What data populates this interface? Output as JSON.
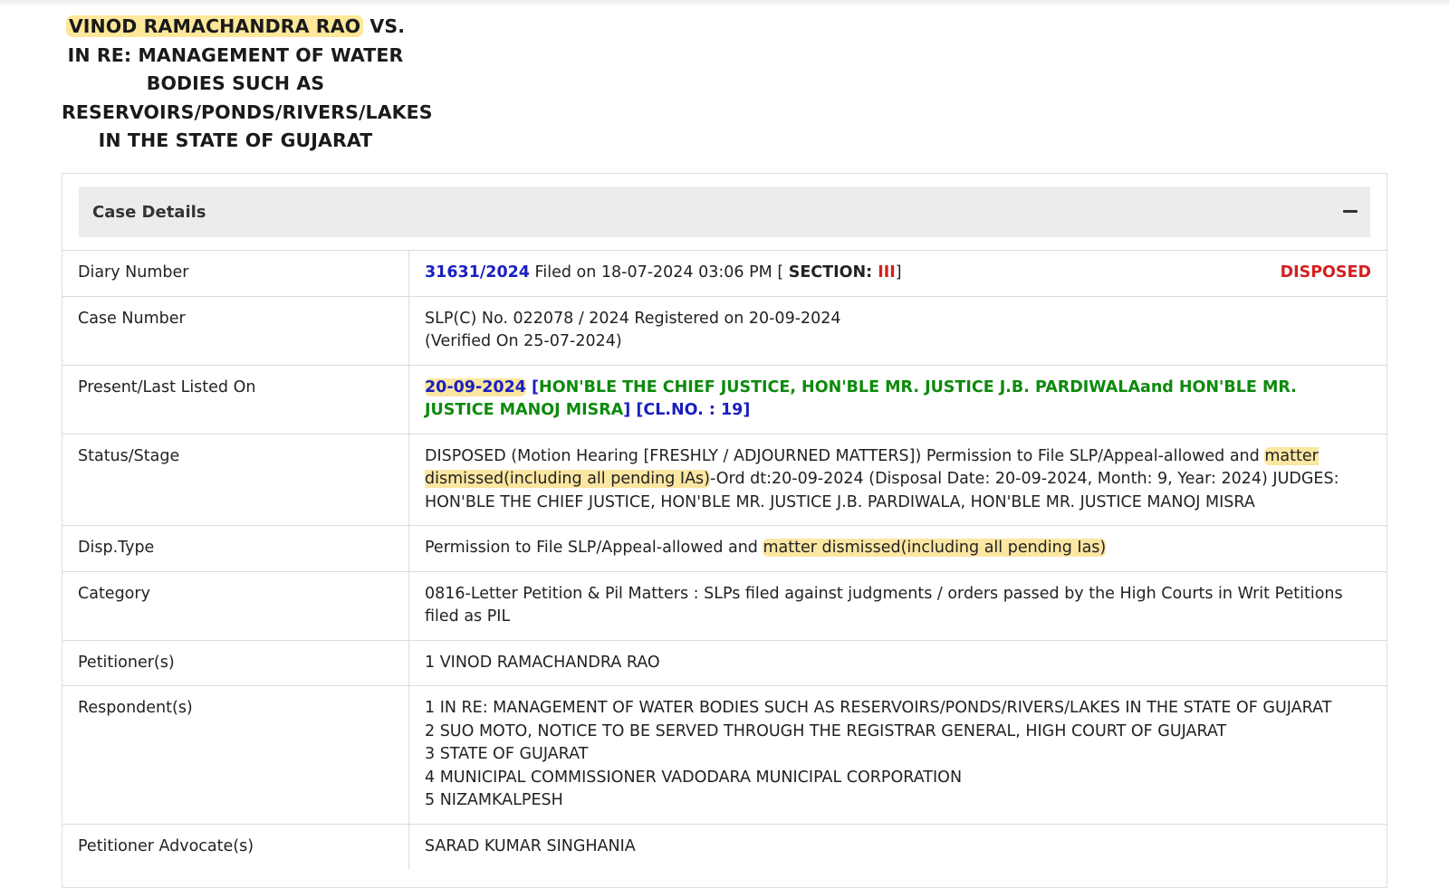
{
  "case_title": {
    "petitioner": "VINOD RAMACHANDRA RAO",
    "rest": " VS. IN RE: MANAGEMENT OF WATER BODIES SUCH AS RESERVOIRS/PONDS/RIVERS/LAKES IN THE STATE OF GUJARAT"
  },
  "card": {
    "header": "Case Details",
    "collapse_icon": "minus-icon"
  },
  "diary": {
    "label": "Diary Number",
    "number": "31631/2024",
    "filed": " Filed on 18-07-2024 03:06 PM [ ",
    "section_label": "SECTION: ",
    "section_value": "III",
    "close": "]",
    "status": "DISPOSED"
  },
  "case_number": {
    "label": "Case Number",
    "line1": "SLP(C) No. 022078 / 2024 Registered on 20-09-2024",
    "line2": "(Verified On 25-07-2024)"
  },
  "listed": {
    "label": "Present/Last Listed On",
    "date": "20-09-2024",
    "bench_open": " [",
    "bench": "HON'BLE THE CHIEF JUSTICE, HON'BLE MR. JUSTICE J.B. PARDIWALAand HON'BLE MR. JUSTICE MANOJ MISRA",
    "bench_close": "]",
    "clno": " [CL.NO. : 19]"
  },
  "status": {
    "label": "Status/Stage",
    "part1": "DISPOSED (Motion Hearing [FRESHLY / ADJOURNED MATTERS]) Permission to File SLP/Appeal-allowed and ",
    "highlight": "matter dismissed(including all pending IAs)",
    "part2": "-Ord dt:20-09-2024 (Disposal Date: 20-09-2024, Month: 9, Year: 2024) JUDGES: HON'BLE THE CHIEF JUSTICE, HON'BLE MR. JUSTICE J.B. PARDIWALA, HON'BLE MR. JUSTICE MANOJ MISRA"
  },
  "disp_type": {
    "label": "Disp.Type",
    "part1": "Permission to File SLP/Appeal-allowed and ",
    "highlight": "matter dismissed(including all pending Ias)"
  },
  "category": {
    "label": "Category",
    "value": "0816-Letter Petition & Pil Matters : SLPs filed against judgments / orders passed by the High Courts in Writ Petitions filed as PIL"
  },
  "petitioners": {
    "label": "Petitioner(s)",
    "items": [
      "1 VINOD RAMACHANDRA RAO"
    ]
  },
  "respondents": {
    "label": "Respondent(s)",
    "items": [
      "1 IN RE: MANAGEMENT OF WATER BODIES SUCH AS RESERVOIRS/PONDS/RIVERS/LAKES IN THE STATE OF GUJARAT",
      "2 SUO MOTO, NOTICE TO BE SERVED THROUGH THE REGISTRAR GENERAL, HIGH COURT OF GUJARAT",
      "3 STATE OF GUJARAT",
      "4 MUNICIPAL COMMISSIONER VADODARA MUNICIPAL CORPORATION",
      "5 NIZAMKALPESH"
    ]
  },
  "pet_advocate": {
    "label": "Petitioner Advocate(s)",
    "value": "SARAD KUMAR SINGHANIA"
  },
  "colors": {
    "highlight": "#fde79a",
    "link_blue": "#1a1fbf",
    "bench_green": "#0c8a0c",
    "status_red": "#d41f1f",
    "header_bg": "#ececec"
  }
}
